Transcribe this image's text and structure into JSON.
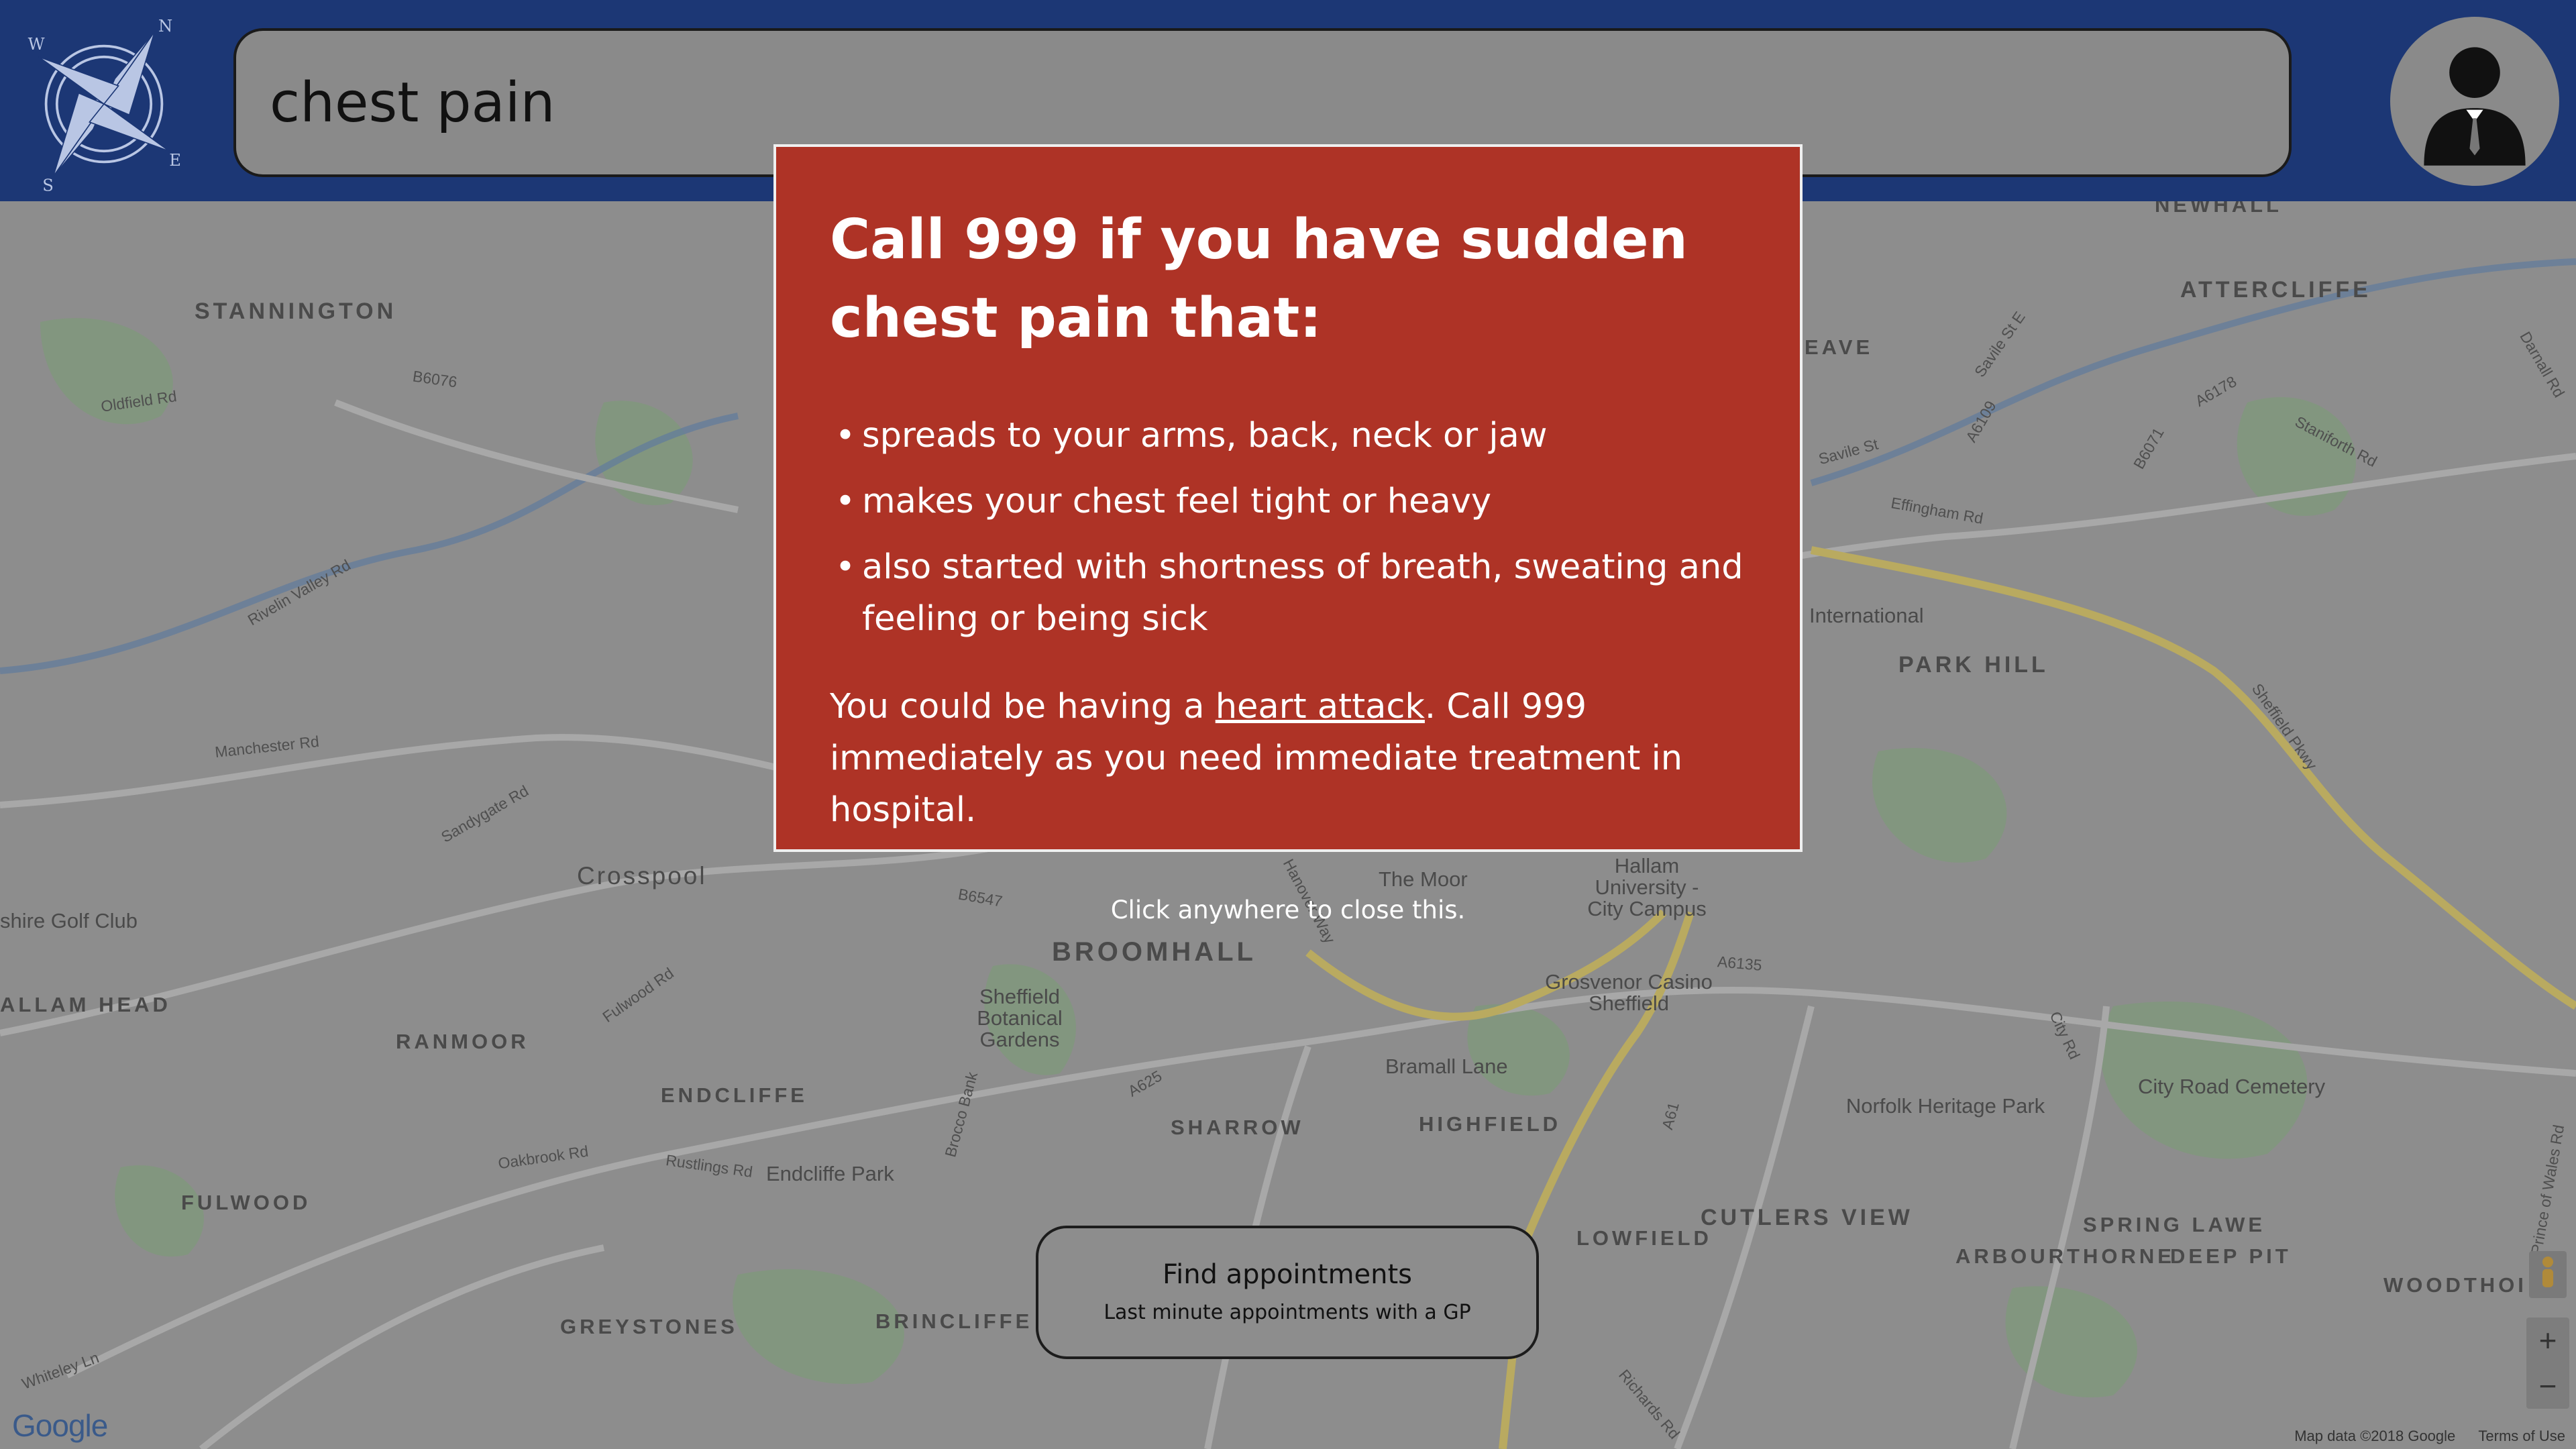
{
  "header": {
    "search_value": "chest pain"
  },
  "alert": {
    "title": "Call 999 if you have sudden chest pain that:",
    "bullets": [
      "spreads to your arms, back, neck or jaw",
      "makes your chest feel tight or heavy",
      "also started with shortness of breath, sweating and feeling or being sick"
    ],
    "advice_before": "You could be having a ",
    "advice_link": "heart attack",
    "advice_after": ". Call 999 immediately as you need immediate treatment in hospital.",
    "close_hint": "Click anywhere to close this."
  },
  "appointments_button": {
    "title": "Find appointments",
    "subtitle": "Last minute appointments with a GP"
  },
  "map": {
    "areas": [
      "STANNINGTON",
      "ATTERCLIFFE",
      "PARK HILL",
      "Crosspool",
      "BROOMHALL",
      "ALLAM HEAD",
      "RANMOOR",
      "ENDCLIFFE",
      "SHARROW",
      "HIGHFIELD",
      "FULWOOD",
      "LOWFIELD",
      "CUTLERS VIEW",
      "SPRING LAWE",
      "ARBOURTHORNE",
      "DEEP PIT",
      "GREYSTONES",
      "BRINCLIFFE",
      "WOODTHOI",
      "NEWHALL",
      "EAVE"
    ],
    "places": [
      "shire Golf Club",
      "The Moor",
      "Hallam University - City Campus",
      "Grosvenor Casino Sheffield",
      "Sheffield Botanical Gardens",
      "Bramall Lane",
      "City Road Cemetery",
      "Norfolk Heritage Park",
      "Endcliffe Park",
      "International"
    ],
    "roads": [
      "Oldfield Rd",
      "B6076",
      "Rivelin Valley Rd",
      "Manchester Rd",
      "Sandygate Rd",
      "Fulwood Rd",
      "Hanover Way",
      "B6547",
      "A625",
      "Brocco Bank",
      "Oakbrook Rd",
      "Rustlings Rd",
      "Whiteley Ln",
      "A61",
      "City Rd",
      "Richards Rd",
      "Savile St",
      "Effingham Rd",
      "Staniforth Rd",
      "A6178",
      "B6071",
      "A6109",
      "Sheffield Pkwy",
      "A6135",
      "Savile St E",
      "Prince of Wales Rd",
      "Darnall Rd"
    ],
    "attribution": [
      "Map data ©2018 Google",
      "Terms of Use"
    ],
    "logo": "Google",
    "zoom_in": "+",
    "zoom_out": "−"
  },
  "icons": {
    "logo": "compass-rose-icon",
    "profile": "user-avatar-icon",
    "pegman": "street-view-icon"
  },
  "colors": {
    "header_bg": "#1c3775",
    "alert_bg": "#ae3326",
    "map_overlay": "#8d8d8d"
  }
}
